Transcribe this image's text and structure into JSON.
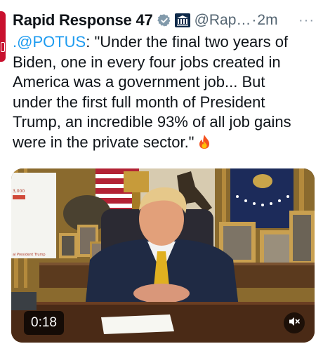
{
  "tweet": {
    "display_name": "Rapid Response 47",
    "handle": "@Rap…",
    "separator": "·",
    "timestamp": "2m",
    "more": "···",
    "text_lines": {
      "l1_mention": ".@POTUS",
      "l1_rest": ": \"Under the final two years of",
      "l2": "Biden, one in every four jobs created in",
      "l3": "America was a government job... But",
      "l4": "under the first full month of President",
      "l5": "Trump, an incredible 93% of all job gains",
      "l6": "were in the private sector.\""
    }
  },
  "media": {
    "duration": "0:18",
    "chart_label_top": "3,000",
    "chart_label_bottom": "al President Trump"
  },
  "icons": {
    "verified": "verified-badge-icon",
    "government": "government-building-icon",
    "fire": "fire-emoji-icon",
    "mute": "speaker-muted-icon",
    "more": "more-options-icon"
  },
  "colors": {
    "accent": "#1d9bf0",
    "verified_gray": "#829aab",
    "text": "#0f1419",
    "secondary_text": "#536471"
  }
}
